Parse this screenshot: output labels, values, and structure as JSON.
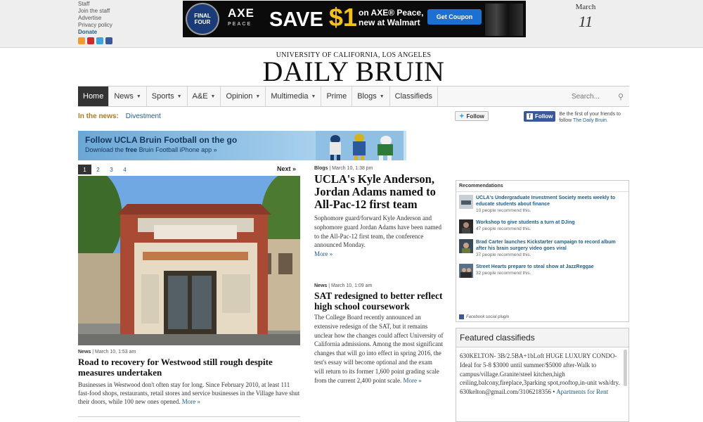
{
  "top_links": [
    "Staff",
    "Join the staff",
    "Advertise",
    "Privacy policy"
  ],
  "donate": "Donate",
  "social_icons": [
    "rss-icon",
    "youtube-icon",
    "twitter-icon",
    "facebook-icon"
  ],
  "ad": {
    "badge": "FINAL FOUR",
    "brand": "AXE",
    "brand_sub": "PEACE",
    "save": "SAVE ",
    "amount": "$1",
    "text_line1": "on AXE® Peace,",
    "text_line2": "new at Walmart",
    "button": "Get Coupon"
  },
  "date": {
    "month": "March",
    "day": "11"
  },
  "masthead": {
    "subtitle": "UNIVERSITY OF CALIFORNIA, LOS ANGELES",
    "title": "DAILY BRUIN"
  },
  "nav": {
    "items": [
      {
        "label": "Home",
        "caret": false
      },
      {
        "label": "News",
        "caret": true
      },
      {
        "label": "Sports",
        "caret": true
      },
      {
        "label": "A&E",
        "caret": true
      },
      {
        "label": "Opinion",
        "caret": true
      },
      {
        "label": "Multimedia",
        "caret": true
      },
      {
        "label": "Prime",
        "caret": false
      },
      {
        "label": "Blogs",
        "caret": true
      },
      {
        "label": "Classifieds",
        "caret": false
      }
    ],
    "search_placeholder": "Search..."
  },
  "in_the_news": {
    "label": "In the news:",
    "link": "Divestment"
  },
  "twitter_follow": "Follow",
  "facebook": {
    "button": "Follow",
    "text_pre": "Be the first of your friends to follow ",
    "text_link": "The Daily Bruin",
    "text_post": "."
  },
  "promo": {
    "headline": "Follow UCLA Bruin Football on the go",
    "sub_pre": "Download the ",
    "sub_bold": "free",
    "sub_post": " Bruin Football iPhone app »"
  },
  "slideshow": {
    "pages": [
      "1",
      "2",
      "3",
      "4"
    ],
    "active": 0,
    "next": "Next »"
  },
  "lead_story": {
    "section": "News",
    "date": " | March 10, 1:53 am",
    "headline": "Road to recovery for Westwood still rough despite measures undertaken",
    "body": "Businesses in Westwood don't often stay for long. Since February 2010, at least 111 fast-food shops, restaurants, retail stores and service businesses in the Village have shut their doors, while 100 new ones opened.",
    "more": "More »"
  },
  "stories": [
    {
      "section": "Blogs",
      "date": " | March 10, 1:38 pm",
      "headline": "UCLA's Kyle Anderson, Jordan Adams named to All-Pac-12 first team",
      "body": "Sophomore guard/forward Kyle Anderson and sophomore guard Jordan Adams have been named to the All-Pac-12 first team, the conference announced Monday.",
      "more": "More »"
    },
    {
      "section": "News",
      "date": " | March 10, 1:09 am",
      "headline": "SAT redesigned to better reflect high school coursework",
      "body": "The College Board recently announced an extensive redesign of the SAT, but it remains unclear how the changes could affect University of California admissions. Among the most significant changes that will go into effect in spring 2016, the test's essay will become optional and the exam will return to its former 1,600 point grading scale from the current 2,400 point scale.",
      "more": "More »"
    }
  ],
  "recommendations": {
    "title": "Recommendations",
    "items": [
      {
        "title": "UCLA's Undergraduate Investment Society meets weekly to educate students about finance",
        "count": "10 people recommend this."
      },
      {
        "title": "Workshop to give students a turn at DJing",
        "count": "47 people recommend this."
      },
      {
        "title": "Brad Carter launches Kickstarter campaign to record album after his brain surgery video goes viral",
        "count": "37 people recommend this."
      },
      {
        "title": "Street Hearts prepare to steal show at JazzReggae",
        "count": "32 people recommend this."
      }
    ],
    "plugin": "Facebook social plugin"
  },
  "classifieds": {
    "title": "Featured classifieds",
    "body": "630KELTON- 3B/2.5BA+1bLoft HUGE LUXURY CONDO-Ideal for 5-8 $3000 until summer/$5000 after-Walk to campus/village.Granite/steel kitchen,high ceiling,balcony,fireplace,3parking spot,rooftop,in-unit wsh/dry. 630kelton@gmail.com/3106218356 • ",
    "category": "Apartments for Rent"
  }
}
